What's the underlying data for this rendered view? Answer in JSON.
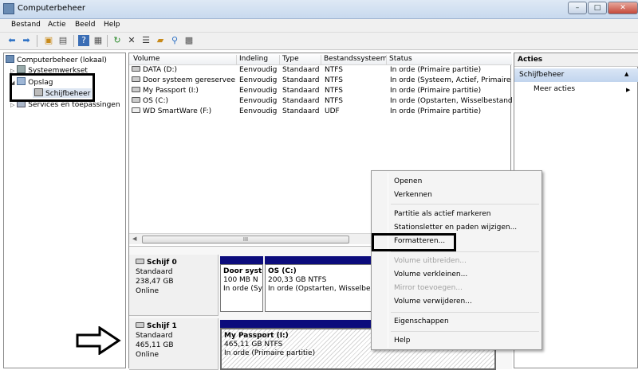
{
  "window": {
    "title": "Computerbeheer"
  },
  "menubar": {
    "items": [
      "Bestand",
      "Actie",
      "Beeld",
      "Help"
    ]
  },
  "tree": {
    "root": "Computerbeheer (lokaal)",
    "systeemwerkset": "Systeemwerkset",
    "opslag": "Opslag",
    "schijfbeheer": "Schijfbeheer",
    "services": "Services en toepassingen"
  },
  "volumes": {
    "headers": [
      "Volume",
      "Indeling",
      "Type",
      "Bestandssysteem",
      "Status"
    ],
    "rows": [
      [
        "DATA (D:)",
        "Eenvoudig",
        "Standaard",
        "NTFS",
        "In orde (Primaire partitie)"
      ],
      [
        "Door systeem gereserveerd",
        "Eenvoudig",
        "Standaard",
        "NTFS",
        "In orde (Systeem, Actief, Primaire pa"
      ],
      [
        "My Passport (I:)",
        "Eenvoudig",
        "Standaard",
        "NTFS",
        "In orde (Primaire partitie)"
      ],
      [
        "OS (C:)",
        "Eenvoudig",
        "Standaard",
        "NTFS",
        "In orde (Opstarten, Wisselbestand, C"
      ],
      [
        "WD SmartWare (F:)",
        "Eenvoudig",
        "Standaard",
        "UDF",
        "In orde (Primaire partitie)"
      ]
    ],
    "scroll_thumb": "III"
  },
  "disks": [
    {
      "name": "Schijf 0",
      "type": "Standaard",
      "size": "238,47 GB",
      "status": "Online",
      "partitions": [
        {
          "title": "Door syst",
          "size": "100 MB N",
          "status": "In orde (Sy"
        },
        {
          "title": "OS  (C:)",
          "size": "200,33 GB NTFS",
          "status": "In orde (Opstarten, Wisselbesta"
        }
      ]
    },
    {
      "name": "Schijf 1",
      "type": "Standaard",
      "size": "465,11 GB",
      "status": "Online",
      "partitions": [
        {
          "title": "My Passport  (I:)",
          "size": "465,11 GB NTFS",
          "status": "In orde (Primaire partitie)"
        }
      ]
    }
  ],
  "actions": {
    "header": "Acties",
    "section": "Schijfbeheer",
    "more": "Meer acties"
  },
  "context_menu": {
    "items": [
      {
        "label": "Openen",
        "enabled": true
      },
      {
        "label": "Verkennen",
        "enabled": true
      },
      {
        "label": "Partitie als actief markeren",
        "enabled": true
      },
      {
        "label": "Stationsletter en paden wijzigen...",
        "enabled": true
      },
      {
        "label": "Formatteren...",
        "enabled": true
      },
      {
        "label": "Volume uitbreiden...",
        "enabled": false
      },
      {
        "label": "Volume verkleinen...",
        "enabled": true
      },
      {
        "label": "Mirror toevoegen...",
        "enabled": false
      },
      {
        "label": "Volume verwijderen...",
        "enabled": true
      },
      {
        "label": "Eigenschappen",
        "enabled": true
      },
      {
        "label": "Help",
        "enabled": true
      }
    ]
  },
  "colors": {
    "disk_bar": "#0c0c7c",
    "highlight_box": "#000000"
  }
}
